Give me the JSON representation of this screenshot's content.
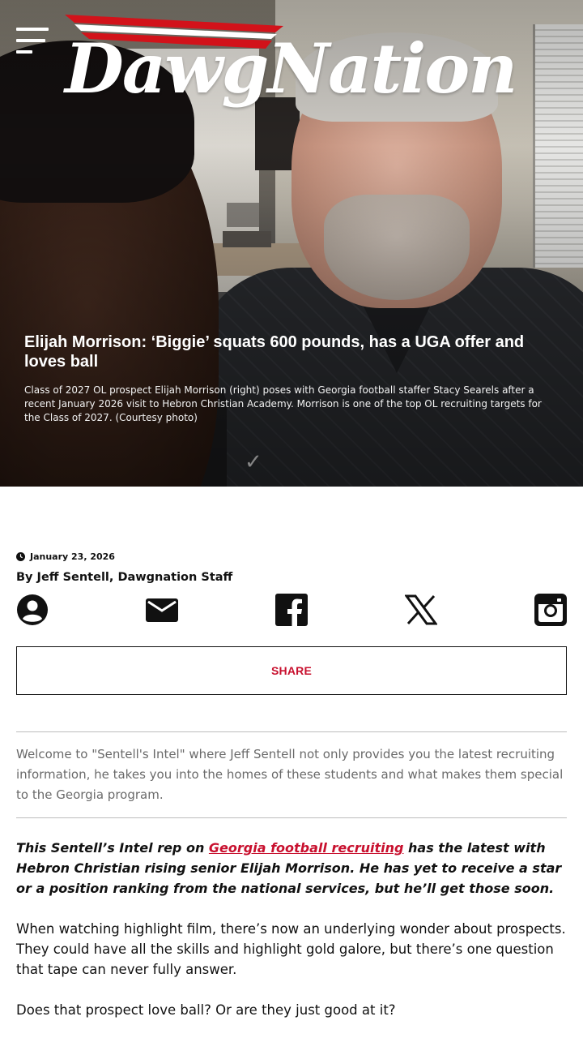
{
  "header": {
    "logo_text": "DawgNation",
    "menu_icon": "hamburger-menu-icon"
  },
  "hero": {
    "title": "Elijah Morrison: ‘Biggie’ squats 600 pounds, has a UGA offer and loves ball",
    "caption": "Class of 2027 OL prospect Elijah Morrison (right) poses with Georgia football staffer Stacy Searels after a recent January 2026 visit to Hebron Christian Academy. Morrison is one of the top OL recruiting targets for the Class of 2027. (Courtesy photo)"
  },
  "meta": {
    "date": "January 23, 2026",
    "byline": "By Jeff Sentell, Dawgnation Staff"
  },
  "share": {
    "icons": [
      "profile-icon",
      "email-icon",
      "facebook-icon",
      "x-icon",
      "instagram-icon"
    ],
    "button_label": "SHARE"
  },
  "article": {
    "intro": "Welcome to \"Sentell's Intel\" where Jeff Sentell not only provides you the latest recruiting information, he takes you into the homes of these students and what makes them special to the Georgia program.",
    "lede_before": "This Sentell’s Intel rep on ",
    "lede_link": "Georgia football recruiting",
    "lede_after": " has the latest with Hebron Christian rising senior Elijah Morrison. He has yet to receive a star or a position ranking from the national services, but he’ll get those soon.",
    "paragraph_1": "When watching highlight film, there’s now an underlying wonder about prospects. They could have all the skills and highlight gold galore, but there’s one question that tape can never fully answer.",
    "paragraph_2": "Does that prospect love ball? Or are they just good at it?"
  },
  "colors": {
    "brand_red": "#c8102e",
    "text": "#111111",
    "muted": "#6a6a6a"
  }
}
